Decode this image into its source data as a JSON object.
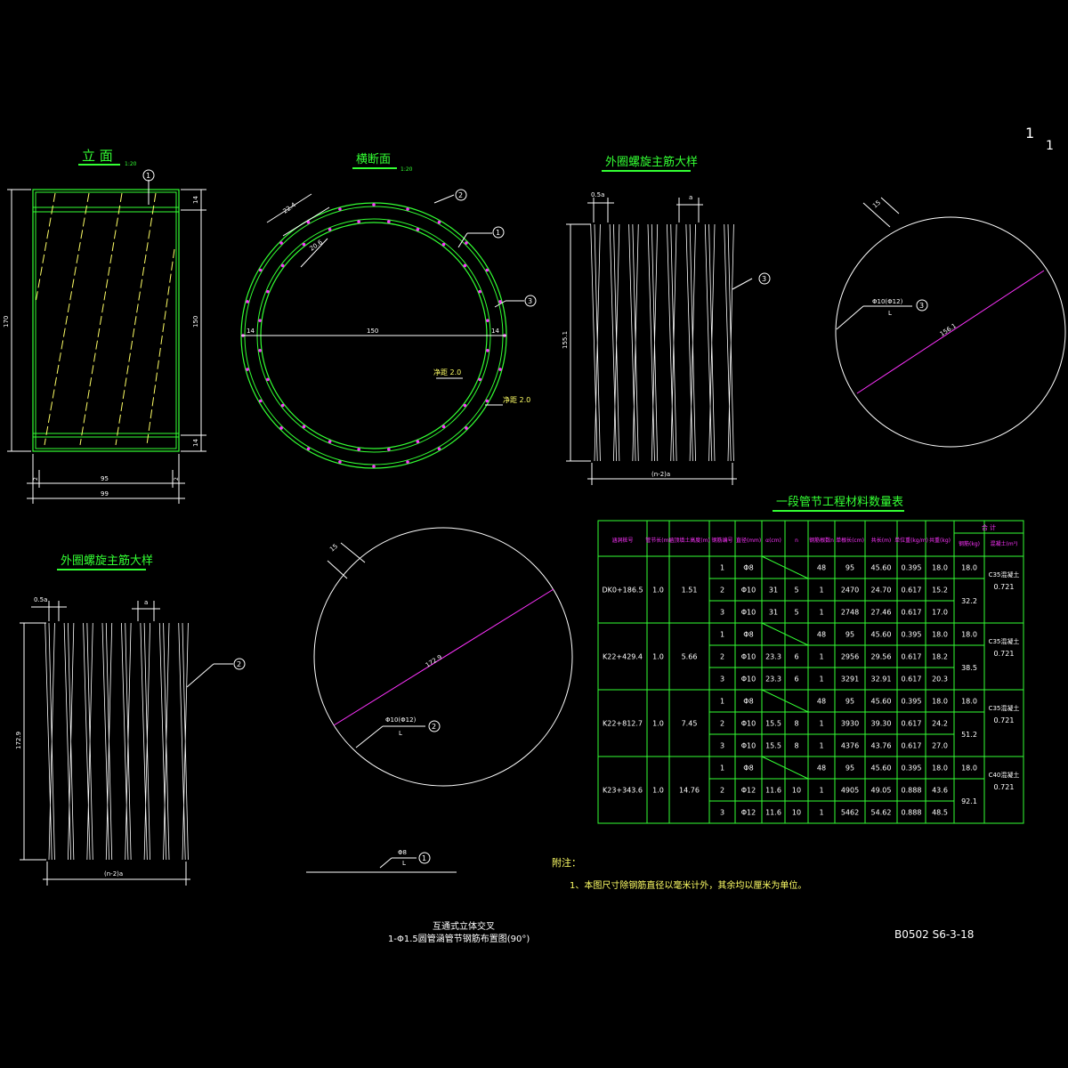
{
  "sheet": {
    "page_no_a": "1",
    "page_no_b": "1",
    "drawing_no": "B0502 S6-3-18",
    "title_line1": "互通式立体交叉",
    "title_line2": "1-Φ1.5圆管涵管节钢筋布置图(90°)"
  },
  "elevation": {
    "title": "立 面",
    "scale": "1:20",
    "dim_height": "170",
    "dim_inner": "150",
    "dim_top": "14",
    "dim_bottom": "14",
    "dim_w_inner": "95",
    "dim_w_outer": "99",
    "dim_side": "2",
    "mark": "1"
  },
  "section": {
    "title": "横断面",
    "scale": "1:20",
    "dim_d": "150",
    "dim_wall_l": "14",
    "dim_wall_r": "14",
    "dim_a": "22.4",
    "dim_b": "20.6",
    "cover_inner": "净距 2.0",
    "cover_outer": "净距 2.0",
    "mark1": "1",
    "mark2": "2",
    "mark3": "3"
  },
  "spiral_a": {
    "title": "外圈螺旋主筋大样",
    "pitch_half": "0.5a",
    "pitch": "a",
    "height": "155.1",
    "length": "(n-2)a",
    "mark": "3"
  },
  "circle_a": {
    "dim_top": "15",
    "diag": "156.1",
    "bar": "Φ10(Φ12)",
    "L": "L",
    "mark": "3"
  },
  "spiral_b": {
    "title": "外圈螺旋主筋大样",
    "pitch_half": "0.5a",
    "pitch": "a",
    "height": "172.9",
    "length": "(n-2)a",
    "mark": "2"
  },
  "circle_b": {
    "dim_top": "15",
    "diag": "172.9",
    "bar": "Φ10(Φ12)",
    "L": "L",
    "mark": "2"
  },
  "bar1": {
    "bar": "Φ8",
    "L": "L",
    "mark": "1"
  },
  "table": {
    "title": "一段管节工程材料数量表",
    "headers": [
      "涵洞桩号",
      "管节长(m)",
      "涵顶填土高度(m)",
      "钢筋编号",
      "直径(mm)",
      "α(cm)",
      "n",
      "钢筋根数n",
      "单根长(cm)",
      "共长(m)",
      "单位重(kg/m)",
      "共重(kg)",
      "合 计",
      "钢筋(kg)",
      "混凝土(m³)"
    ],
    "groups": [
      {
        "station": "DK0+186.5",
        "len": "1.0",
        "fill": "1.51",
        "steel_sum": "18.0",
        "steel_total": "32.2",
        "concrete": "C35混凝土",
        "vol": "0.721",
        "rows": [
          [
            "1",
            "Φ8",
            "",
            "",
            "48",
            "95",
            "45.60",
            "0.395",
            "18.0"
          ],
          [
            "2",
            "Φ10",
            "31",
            "5",
            "1",
            "2470",
            "24.70",
            "0.617",
            "15.2"
          ],
          [
            "3",
            "Φ10",
            "31",
            "5",
            "1",
            "2748",
            "27.46",
            "0.617",
            "17.0"
          ]
        ]
      },
      {
        "station": "K22+429.4",
        "len": "1.0",
        "fill": "5.66",
        "steel_sum": "18.0",
        "steel_total": "38.5",
        "concrete": "C35混凝土",
        "vol": "0.721",
        "rows": [
          [
            "1",
            "Φ8",
            "",
            "",
            "48",
            "95",
            "45.60",
            "0.395",
            "18.0"
          ],
          [
            "2",
            "Φ10",
            "23.3",
            "6",
            "1",
            "2956",
            "29.56",
            "0.617",
            "18.2"
          ],
          [
            "3",
            "Φ10",
            "23.3",
            "6",
            "1",
            "3291",
            "32.91",
            "0.617",
            "20.3"
          ]
        ]
      },
      {
        "station": "K22+812.7",
        "len": "1.0",
        "fill": "7.45",
        "steel_sum": "18.0",
        "steel_total": "51.2",
        "concrete": "C35混凝土",
        "vol": "0.721",
        "rows": [
          [
            "1",
            "Φ8",
            "",
            "",
            "48",
            "95",
            "45.60",
            "0.395",
            "18.0"
          ],
          [
            "2",
            "Φ10",
            "15.5",
            "8",
            "1",
            "3930",
            "39.30",
            "0.617",
            "24.2"
          ],
          [
            "3",
            "Φ10",
            "15.5",
            "8",
            "1",
            "4376",
            "43.76",
            "0.617",
            "27.0"
          ]
        ]
      },
      {
        "station": "K23+343.6",
        "len": "1.0",
        "fill": "14.76",
        "steel_sum": "18.0",
        "steel_total": "92.1",
        "concrete": "C40混凝土",
        "vol": "0.721",
        "rows": [
          [
            "1",
            "Φ8",
            "",
            "",
            "48",
            "95",
            "45.60",
            "0.395",
            "18.0"
          ],
          [
            "2",
            "Φ12",
            "11.6",
            "10",
            "1",
            "4905",
            "49.05",
            "0.888",
            "43.6"
          ],
          [
            "3",
            "Φ12",
            "11.6",
            "10",
            "1",
            "5462",
            "54.62",
            "0.888",
            "48.5"
          ]
        ]
      }
    ]
  },
  "notes": {
    "title": "附注：",
    "line1": "1、本图尺寸除钢筋直径以毫米计外，其余均以厘米为单位。"
  }
}
